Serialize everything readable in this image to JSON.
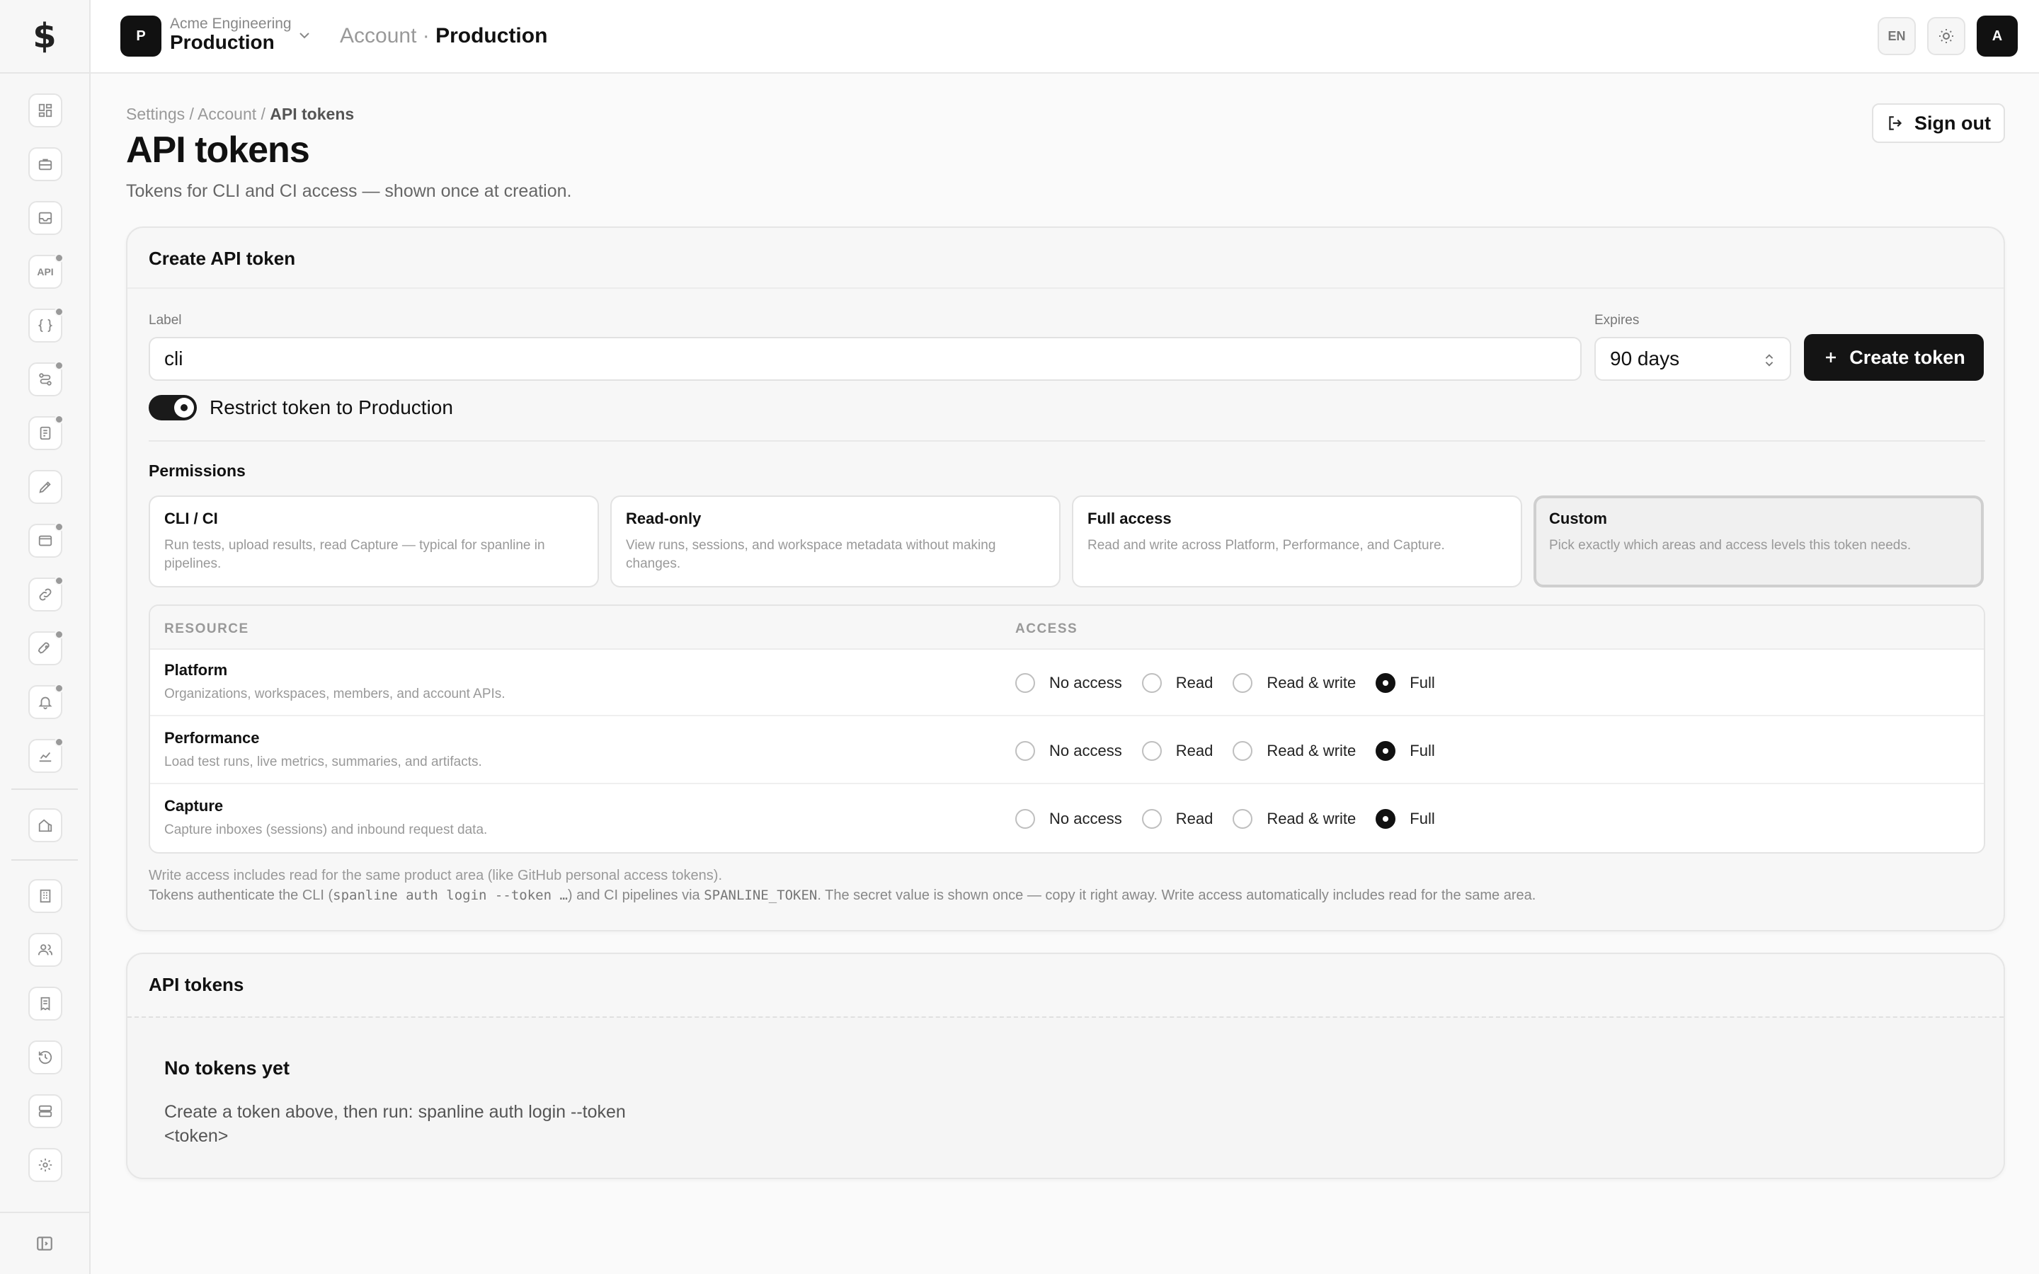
{
  "app": {
    "logo_glyph": "$",
    "accent_color": "#111111"
  },
  "sidebar": {
    "items": [
      {
        "icon": "dashboard-icon",
        "badge": false
      },
      {
        "icon": "briefcase-icon",
        "badge": false
      },
      {
        "icon": "inbox-icon",
        "badge": false
      },
      {
        "icon": "api-icon",
        "badge": true,
        "text": "API"
      },
      {
        "icon": "code-braces-icon",
        "badge": true
      },
      {
        "icon": "workflow-icon",
        "badge": true
      },
      {
        "icon": "clipboard-icon",
        "badge": true
      },
      {
        "icon": "pen-tool-icon",
        "badge": false
      },
      {
        "icon": "mail-icon",
        "badge": true
      },
      {
        "icon": "link-icon",
        "badge": true
      },
      {
        "icon": "rocket-icon",
        "badge": true
      },
      {
        "icon": "bell-icon",
        "badge": true
      },
      {
        "icon": "chart-icon",
        "badge": true
      },
      {
        "icon": "buildings-icon",
        "badge": false
      },
      {
        "icon": "building-icon",
        "badge": false
      },
      {
        "icon": "users-icon",
        "badge": false
      },
      {
        "icon": "receipt-icon",
        "badge": false
      },
      {
        "icon": "history-icon",
        "badge": false
      },
      {
        "icon": "database-icon",
        "badge": false
      },
      {
        "icon": "settings-icon",
        "badge": false
      }
    ],
    "collapse_icon": "sidebar-collapse-icon"
  },
  "topbar": {
    "workspace_initial": "P",
    "org_name": "Acme Engineering",
    "workspace_name": "Production",
    "crumb_parent": "Account",
    "crumb_sep": "·",
    "crumb_current": "Production",
    "lang": "EN",
    "avatar_initial": "A"
  },
  "header": {
    "breadcrumb_1": "Settings",
    "breadcrumb_2": "Account",
    "breadcrumb_3": "API tokens",
    "breadcrumb_sep": "/",
    "title": "API tokens",
    "subtitle": "Tokens for CLI and CI access — shown once at creation.",
    "sign_out_label": "Sign out"
  },
  "create_card": {
    "title": "Create API token",
    "label_field_label": "Label",
    "label_value": "cli",
    "expires_label": "Expires",
    "expires_value": "90 days",
    "create_button": "Create token",
    "restrict_on": true,
    "restrict_label": "Restrict token to Production",
    "permissions_title": "Permissions",
    "presets": [
      {
        "title": "CLI / CI",
        "desc": "Run tests, upload results, read Capture — typical for spanline in pipelines.",
        "selected": false
      },
      {
        "title": "Read-only",
        "desc": "View runs, sessions, and workspace metadata without making changes.",
        "selected": false
      },
      {
        "title": "Full access",
        "desc": "Read and write across Platform, Performance, and Capture.",
        "selected": false
      },
      {
        "title": "Custom",
        "desc": "Pick exactly which areas and access levels this token needs.",
        "selected": true
      }
    ],
    "table": {
      "col_resource": "RESOURCE",
      "col_access": "ACCESS",
      "options": [
        "No access",
        "Read",
        "Read & write",
        "Full"
      ],
      "rows": [
        {
          "name": "Platform",
          "desc": "Organizations, workspaces, members, and account APIs.",
          "selected": "Full"
        },
        {
          "name": "Performance",
          "desc": "Load test runs, live metrics, summaries, and artifacts.",
          "selected": "Full"
        },
        {
          "name": "Capture",
          "desc": "Capture inboxes (sessions) and inbound request data.",
          "selected": "Full"
        }
      ]
    },
    "note_1": "Write access includes read for the same product area (like GitHub personal access tokens).",
    "note_2_a": "Tokens authenticate the CLI (",
    "note_2_code_1": "spanline auth login --token …",
    "note_2_b": ") and CI pipelines via ",
    "note_2_code_2": "SPANLINE_TOKEN",
    "note_2_c": ". The secret value is shown once — copy it right away. Write access automatically includes read for the same area."
  },
  "tokens_card": {
    "title": "API tokens",
    "empty_title": "No tokens yet",
    "empty_desc": "Create a token above, then run: spanline auth login --token <token>"
  }
}
